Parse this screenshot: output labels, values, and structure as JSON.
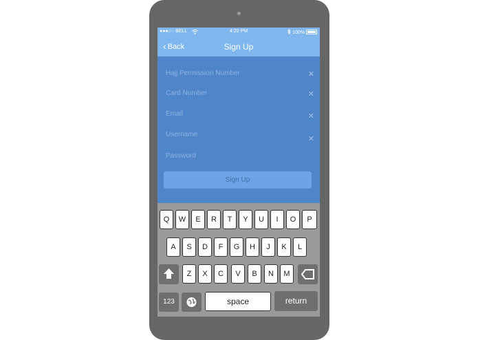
{
  "status": {
    "carrier": "●●●○○ BELL",
    "time": "4:20 PM",
    "battery": "100%",
    "wifi_icon": "wifi-icon",
    "bluetooth_icon": "bluetooth-icon"
  },
  "nav": {
    "back": "Back",
    "title": "Sign Up"
  },
  "form": {
    "fields": [
      {
        "placeholder": "Hajj Permission Number"
      },
      {
        "placeholder": "Card Number"
      },
      {
        "placeholder": "Email"
      },
      {
        "placeholder": "Username"
      },
      {
        "placeholder": "Password"
      }
    ],
    "clear_symbol": "✕",
    "submit": "Sign Up"
  },
  "keyboard": {
    "row1": [
      "Q",
      "W",
      "E",
      "R",
      "T",
      "Y",
      "U",
      "I",
      "O",
      "P"
    ],
    "row2": [
      "A",
      "S",
      "D",
      "F",
      "G",
      "H",
      "J",
      "K",
      "L"
    ],
    "row3": [
      "Z",
      "X",
      "C",
      "V",
      "B",
      "N",
      "M"
    ],
    "numbers": "123",
    "space": "space",
    "return": "return",
    "shift_icon": "shift-arrow-icon",
    "delete_icon": "backspace-icon",
    "globe_icon": "globe-icon"
  },
  "colors": {
    "phone": "#666666",
    "bar": "#7fb6ee",
    "screen": "#4f86c9",
    "button": "#6ea4e6"
  }
}
